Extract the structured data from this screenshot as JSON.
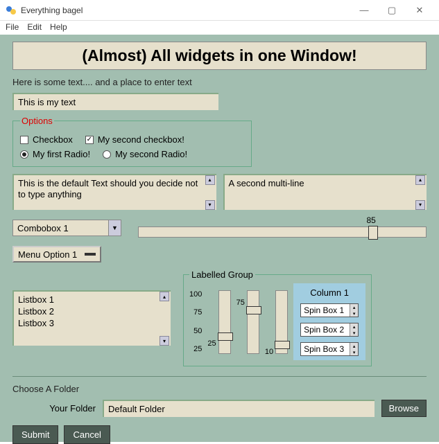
{
  "window": {
    "title": "Everything bagel"
  },
  "menubar": {
    "file": "File",
    "edit": "Edit",
    "help": "Help"
  },
  "banner": "(Almost) All widgets in one Window!",
  "intro": "Here is some text.... and a place to enter text",
  "text_input": "This is my text",
  "options": {
    "legend": "Options",
    "cb1": "Checkbox",
    "cb2": "My second checkbox!",
    "r1": "My first Radio!",
    "r2": "My second Radio!"
  },
  "ml1": "This is the default Text should you decide not to type anything",
  "ml2": "A second multi-line",
  "combo": "Combobox 1",
  "slider_value": "85",
  "menu_option": "Menu Option 1",
  "listbox": {
    "i0": "Listbox 1",
    "i1": "Listbox 2",
    "i2": "Listbox 3"
  },
  "labelled_group": {
    "legend": "Labelled Group",
    "t100": "100",
    "t75": "75",
    "t50": "50",
    "t25": "25",
    "v1": "25",
    "v2": "75",
    "v3": "10",
    "col": "Column 1",
    "s1": "Spin Box 1",
    "s2": "Spin Box 2",
    "s3": "Spin Box 3"
  },
  "folder": {
    "heading": "Choose A Folder",
    "label": "Your Folder",
    "value": "Default Folder",
    "browse": "Browse"
  },
  "buttons": {
    "submit": "Submit",
    "cancel": "Cancel"
  }
}
